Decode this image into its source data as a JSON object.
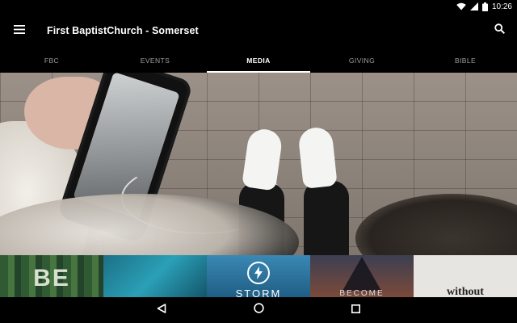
{
  "status_bar": {
    "time": "10:26",
    "icons": [
      "wifi-icon",
      "signal-icon",
      "battery-icon"
    ]
  },
  "app_bar": {
    "title": "First BaptistChurch - Somerset",
    "menu_icon": "hamburger-menu-icon",
    "search_icon": "search-icon"
  },
  "tabs": [
    {
      "label": "FBC",
      "active": false
    },
    {
      "label": "EVENTS",
      "active": false
    },
    {
      "label": "MEDIA",
      "active": true
    },
    {
      "label": "GIVING",
      "active": false
    },
    {
      "label": "BIBLE",
      "active": false
    }
  ],
  "media_tiles": [
    {
      "text": "BE"
    },
    {
      "text": ""
    },
    {
      "text": "STORM"
    },
    {
      "text": "BECOME"
    },
    {
      "text": "without"
    }
  ],
  "nav_bar": {
    "icons": [
      "back-icon",
      "home-icon",
      "recents-icon"
    ]
  },
  "colors": {
    "background": "#000000",
    "text": "#ffffff",
    "tab_inactive": "#9e9e9e",
    "tab_indicator": "#ffffff"
  }
}
